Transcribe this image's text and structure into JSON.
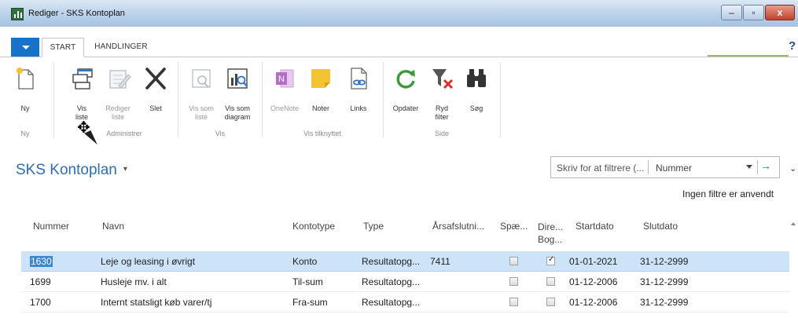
{
  "window": {
    "title": "Rediger - SKS Kontoplan",
    "controls": {
      "minimize": "–",
      "maximize": "▫",
      "close": "x"
    }
  },
  "ribbon_tabs": [
    {
      "label": "START",
      "active": true
    },
    {
      "label": "HANDLINGER",
      "active": false
    }
  ],
  "ribbon": {
    "groups": [
      {
        "label": "Ny",
        "buttons": [
          {
            "label": "Ny",
            "icon": "new-page-icon",
            "enabled": true
          }
        ]
      },
      {
        "label": "Administrer",
        "buttons": [
          {
            "label": "Vis\nliste",
            "icon": "view-list-icon",
            "enabled": true
          },
          {
            "label": "Rediger\nliste",
            "icon": "edit-list-icon",
            "enabled": false
          },
          {
            "label": "Slet",
            "icon": "delete-x-icon",
            "enabled": true
          }
        ]
      },
      {
        "label": "Vis",
        "buttons": [
          {
            "label": "Vis som\nliste",
            "icon": "view-as-list-icon",
            "enabled": false
          },
          {
            "label": "Vis som\ndiagram",
            "icon": "view-as-chart-icon",
            "enabled": true
          }
        ]
      },
      {
        "label": "Vis tilknyttet",
        "buttons": [
          {
            "label": "OneNote",
            "icon": "onenote-icon",
            "enabled": false
          },
          {
            "label": "Noter",
            "icon": "note-icon",
            "enabled": true
          },
          {
            "label": "Links",
            "icon": "links-icon",
            "enabled": true
          }
        ]
      },
      {
        "label": "Side",
        "buttons": [
          {
            "label": "Opdater",
            "icon": "refresh-icon",
            "enabled": true
          },
          {
            "label": "Ryd\nfilter",
            "icon": "clear-filter-icon",
            "enabled": true
          },
          {
            "label": "Søg",
            "icon": "binoculars-icon",
            "enabled": true
          }
        ]
      }
    ]
  },
  "page": {
    "title": "SKS Kontoplan",
    "title_caret": "▾",
    "filter": {
      "placeholder": "Skriv for at filtrere (...",
      "field": "Nummer",
      "go_glyph": "→"
    },
    "expand_glyph": "⌄",
    "no_filter_text": "Ingen filtre er anvendt"
  },
  "grid": {
    "columns": [
      "Nummer",
      "Navn",
      "Kontotype",
      "Type",
      "Årsafslutni...",
      "Spæ...",
      "Dire...\nBog...",
      "Startdato",
      "Slutdato"
    ],
    "rows": [
      {
        "nummer": "1630",
        "navn": "Leje og leasing i øvrigt",
        "kontotype": "Konto",
        "type": "Resultatopg...",
        "aarsafslutning": "7411",
        "spaerret": false,
        "direkte_bogfoering": true,
        "startdato": "01-01-2021",
        "slutdato": "31-12-2999",
        "selected": true
      },
      {
        "nummer": "1699",
        "navn": "Husleje mv. i alt",
        "kontotype": "Til-sum",
        "type": "Resultatopg...",
        "aarsafslutning": "",
        "spaerret": false,
        "direkte_bogfoering": false,
        "startdato": "01-12-2006",
        "slutdato": "31-12-2999",
        "selected": false
      },
      {
        "nummer": "1700",
        "navn": "Internt statsligt køb varer/tj",
        "kontotype": "Fra-sum",
        "type": "Resultatopg...",
        "aarsafslutning": "",
        "spaerret": false,
        "direkte_bogfoering": false,
        "startdato": "01-12-2006",
        "slutdato": "31-12-2999",
        "selected": false
      }
    ]
  },
  "colors": {
    "accent": "#1673c7",
    "title_blue": "#2f6db5",
    "selected_row": "#cde3f7",
    "tab_underline": "#9bbb59"
  }
}
